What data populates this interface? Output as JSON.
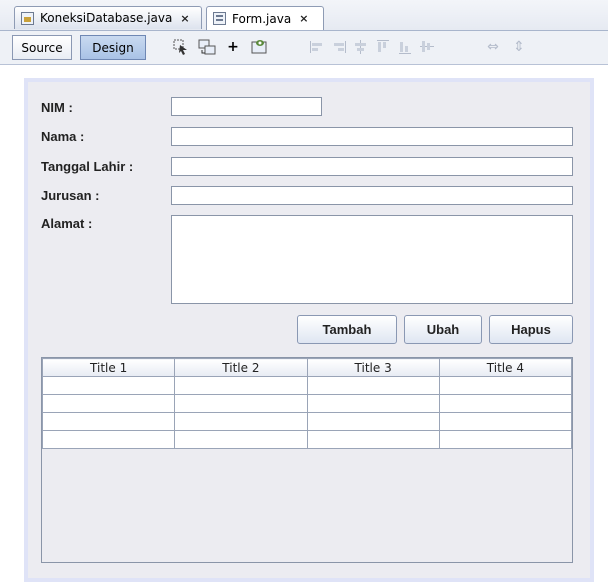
{
  "tabs": [
    {
      "label": "KoneksiDatabase.java",
      "icon": "java-file-icon",
      "active": false
    },
    {
      "label": "Form.java",
      "icon": "form-file-icon",
      "active": true
    }
  ],
  "toolbar": {
    "source_label": "Source",
    "design_label": "Design"
  },
  "form": {
    "labels": {
      "nim": "NIM :",
      "nama": "Nama :",
      "tanggal_lahir": "Tanggal Lahir :",
      "jurusan": "Jurusan :",
      "alamat": "Alamat :"
    },
    "values": {
      "nim": "",
      "nama": "",
      "tanggal_lahir": "",
      "jurusan": "",
      "alamat": ""
    },
    "buttons": {
      "tambah": "Tambah",
      "ubah": "Ubah",
      "hapus": "Hapus"
    }
  },
  "table": {
    "columns": [
      "Title 1",
      "Title 2",
      "Title 3",
      "Title 4"
    ],
    "rows": [
      [
        "",
        "",
        "",
        ""
      ],
      [
        "",
        "",
        "",
        ""
      ],
      [
        "",
        "",
        "",
        ""
      ],
      [
        "",
        "",
        "",
        ""
      ]
    ]
  }
}
